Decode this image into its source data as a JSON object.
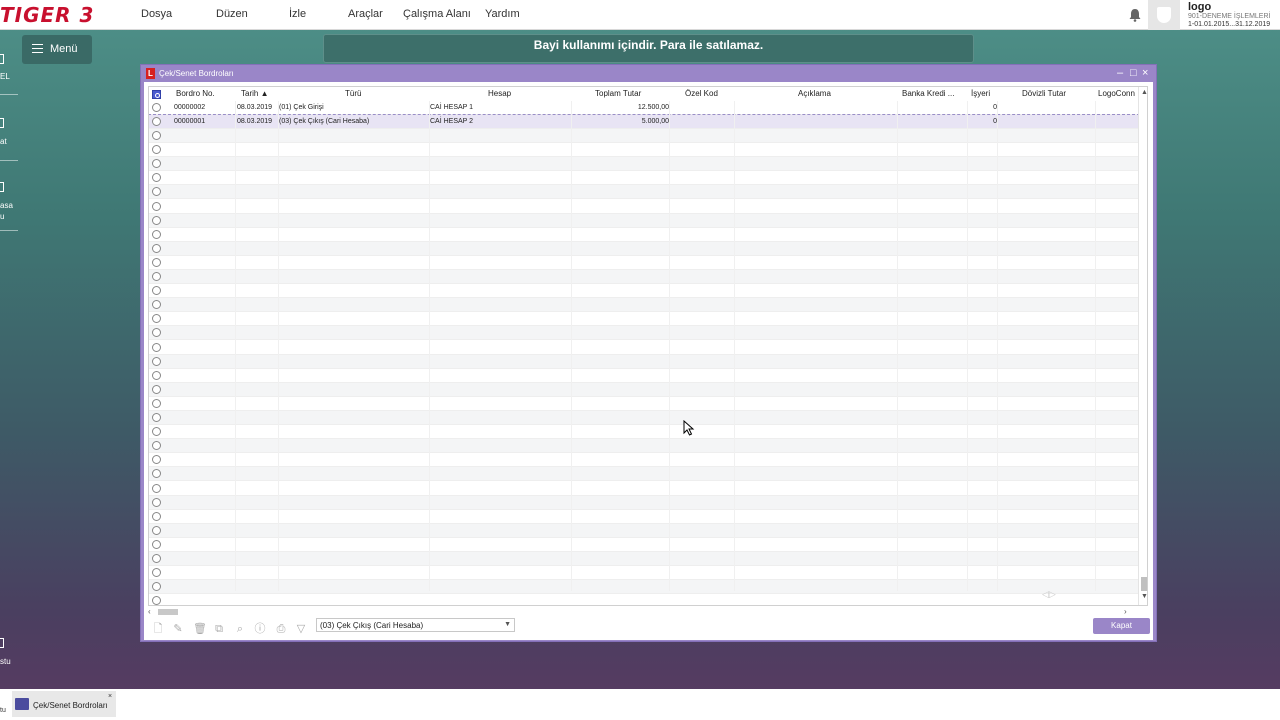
{
  "app": {
    "brand": "TIGER 3",
    "menu": [
      "Dosya",
      "Düzen",
      "İzle",
      "Araçlar",
      "Çalışma Alanı",
      "Yardım"
    ],
    "user": {
      "name": "logo",
      "line1": "901-DENEME İŞLEMLERİ",
      "line2": "1-01.01.2015...31.12.2019"
    }
  },
  "left_strip": {
    "labels": [
      "EL",
      "at",
      "asa",
      "u",
      "stu"
    ]
  },
  "side_menu": {
    "label": "Menü"
  },
  "banner": {
    "text": "Bayi kullanımı içindir. Para ile satılamaz."
  },
  "window": {
    "title": "Çek/Senet Bordroları",
    "columns": [
      "Bordro No.",
      "Tarih",
      "Türü",
      "Hesap",
      "Toplam Tutar",
      "Özel Kod",
      "Açıklama",
      "Banka Kredi ...",
      "İşyeri",
      "Dövizli Tutar",
      "LogoConn"
    ],
    "sort_indicator": "▲",
    "rows": [
      {
        "bordro_no": "00000002",
        "tarih": "08.03.2019",
        "turu": "(01) Çek Girişi",
        "hesap": "CAİ HESAP 1",
        "toplam": "12.500,00",
        "isyeri": "0"
      },
      {
        "bordro_no": "00000001",
        "tarih": "08.03.2019",
        "turu": "(03) Çek Çıkış (Cari Hesaba)",
        "hesap": "CAİ HESAP 2",
        "toplam": "5.000,00",
        "isyeri": "0"
      }
    ],
    "filter_value": "(03) Çek Çıkış (Cari Hesaba)",
    "close_button": "Kapat"
  },
  "taskbar": {
    "item": "Çek/Senet Bordroları",
    "left_label": "tu"
  },
  "colors": {
    "accent": "#9a86c8",
    "brand_red": "#c8102e",
    "banner_bg": "#3d6f6a"
  },
  "icons": [
    "bell-icon",
    "hamburger-icon",
    "app-icon",
    "minimize-icon",
    "maximize-icon",
    "close-icon",
    "new-doc-icon",
    "edit-icon",
    "delete-icon",
    "view-icon",
    "search-icon",
    "info-icon",
    "print-icon",
    "filter-icon"
  ]
}
